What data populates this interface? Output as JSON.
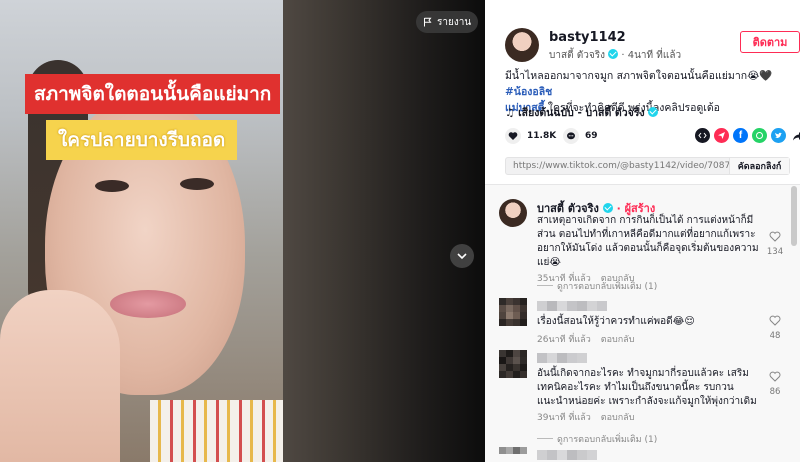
{
  "video": {
    "caption_red": "สภาพจิตใตตอนนั้นคือแย่มาก",
    "caption_yellow": "ใครปลายบางรีบถอด",
    "report_label": "รายงาน"
  },
  "profile": {
    "username": "basty1142",
    "display_name": "บาสตี้ ตัวจริง",
    "time_ago": "4นาที ที่แล้ว",
    "follow_label": "ติดตาม"
  },
  "description": {
    "text": "มีน้ำไหลออกมาจากจมูก สภาพจิตใจตอนนั้นคือแย่มาก😭🖤 ",
    "hashtag1": "#น้องอลิช",
    "hashtag2": "แม่บาสตี้",
    "text2": " ใครที่จะทำคิดดีดี พรุ่งนี้ลงคลิปรอดูเด้อ"
  },
  "music": {
    "label": "♫  เสียงต้นฉบับ - บาสตี้ ตัวจริง"
  },
  "stats": {
    "likes": "11.8K",
    "comments": "69"
  },
  "share": {
    "link": "https://www.tiktok.com/@basty1142/video/70879090568...",
    "copy_label": "คัดลอกลิงก์"
  },
  "comments": [
    {
      "name": "บาสตี้ ตัวจริง",
      "creator_tag": " · ผู้สร้าง",
      "text": "สาเหตุอาจเกิดจาก การกินก็เป็นได้ การแต่งหน้าก็มีส่วน ตอนไปทำที่เกาหลีคือดีมากแต่ที่อยากแก้เพราะอยากให้มันโด่ง แล้วตอนนั้นก็คือจุดเริ่มต้นของความแย่😭",
      "time": "35นาที ที่แล้ว",
      "reply": "ตอบกลับ",
      "likes": "134",
      "more": "ดูการตอบกลับเพิ่มเติม (1)"
    },
    {
      "text": "เรื่องนี้สอนให้รู้ว่าควรทำแค่พอดี😂😌",
      "time": "26นาที ที่แล้ว",
      "reply": "ตอบกลับ",
      "likes": "48"
    },
    {
      "text": "อันนี้เกิดจากอะไรคะ ทำจมูกมากี่รอบแล้วคะ เสริมเทคนิคอะไรคะ ทำไมเป็นถึงขนาดนี้คะ รบกวนแนะนำหน่อยค่ะ เพราะกำลังจะแก้จมูกให้พุ่งกว่าเดิม",
      "time": "39นาที ที่แล้ว",
      "reply": "ตอบกลับ",
      "likes": "86",
      "more": "ดูการตอบกลับเพิ่มเติม (1)"
    }
  ],
  "colors": {
    "accent": "#fe2c55",
    "verified": "#20d5ec"
  }
}
